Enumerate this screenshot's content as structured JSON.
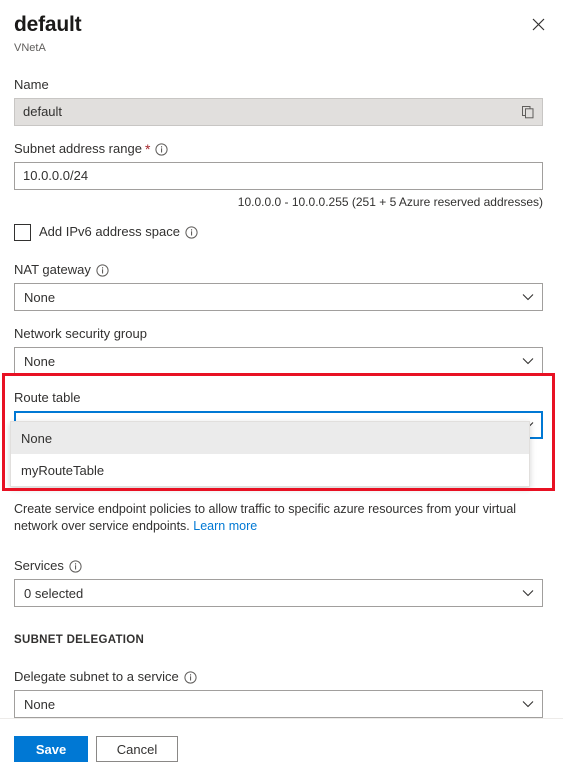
{
  "header": {
    "title": "default",
    "subtitle": "VNetA",
    "close_icon": "close-icon"
  },
  "form": {
    "name": {
      "label": "Name",
      "value": "default",
      "copy_icon": "copy-icon"
    },
    "subnet_address_range": {
      "label": "Subnet address range",
      "required_mark": "*",
      "info_icon": "info-icon",
      "value": "10.0.0.0/24",
      "helper": "10.0.0.0 - 10.0.0.255 (251 + 5 Azure reserved addresses)"
    },
    "ipv6": {
      "label": "Add IPv6 address space",
      "checked": false,
      "info_icon": "info-icon"
    },
    "nat_gateway": {
      "label": "NAT gateway",
      "info_icon": "info-icon",
      "value": "None"
    },
    "network_security_group": {
      "label": "Network security group",
      "value": "None"
    },
    "route_table": {
      "label": "Route table",
      "value": "None",
      "expanded": true,
      "options": [
        {
          "label": "None",
          "hovered": true
        },
        {
          "label": "myRouteTable",
          "hovered": false
        }
      ]
    },
    "service_endpoints": {
      "description": "Create service endpoint policies to allow traffic to specific azure resources from your virtual network over service endpoints.",
      "link_text": "Learn more",
      "services_label": "Services",
      "services_info_icon": "info-icon",
      "services_value": "0 selected"
    },
    "subnet_delegation": {
      "section_title": "SUBNET DELEGATION",
      "label": "Delegate subnet to a service",
      "info_icon": "info-icon",
      "value": "None"
    }
  },
  "footer": {
    "save_label": "Save",
    "cancel_label": "Cancel"
  },
  "colors": {
    "accent": "#0078d4",
    "highlight": "#e81123",
    "required": "#a4262c",
    "hover_row": "#ebebeb"
  }
}
